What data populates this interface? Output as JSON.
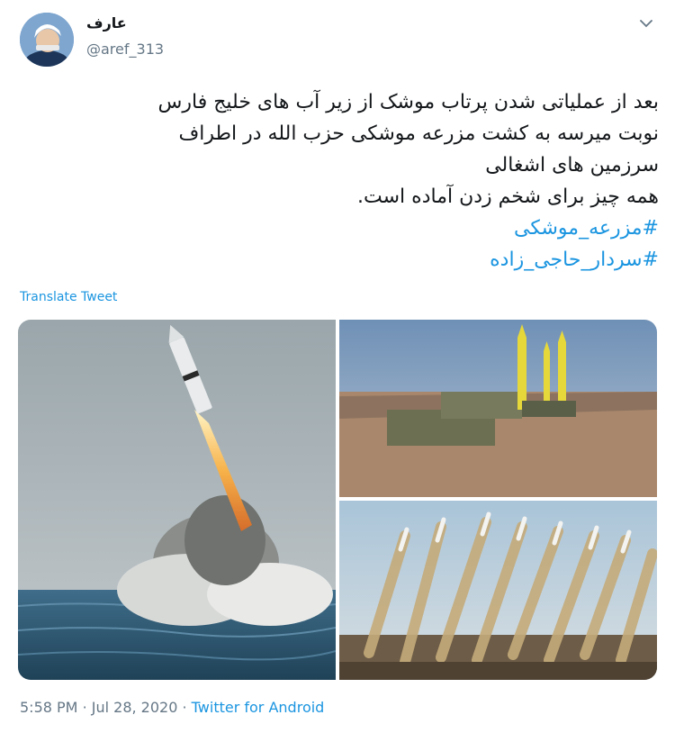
{
  "author": {
    "name": "عارف",
    "handle": "@aref_313",
    "avatar": "avatar"
  },
  "menu_icon": "chevron-down-icon",
  "tweet": {
    "lines": [
      "بعد از عملیاتی شدن پرتاب موشک از زیر آب های خلیج فارس",
      "نوبت میرسه به کشت مزرعه موشکی حزب الله در اطراف",
      "سرزمین های اشغالی",
      "همه چیز برای شخم زدن آماده است."
    ],
    "hashtags": [
      "#مزرعه_موشکی",
      "#سردار_حاجی_زاده"
    ]
  },
  "translate_label": "Translate Tweet",
  "footer": {
    "time": "5:58 PM",
    "separator": "·",
    "date": "Jul 28, 2020",
    "source": "Twitter for Android"
  },
  "colors": {
    "link": "#1b95e0",
    "secondary_text": "#657786",
    "primary_text": "#14171a"
  }
}
